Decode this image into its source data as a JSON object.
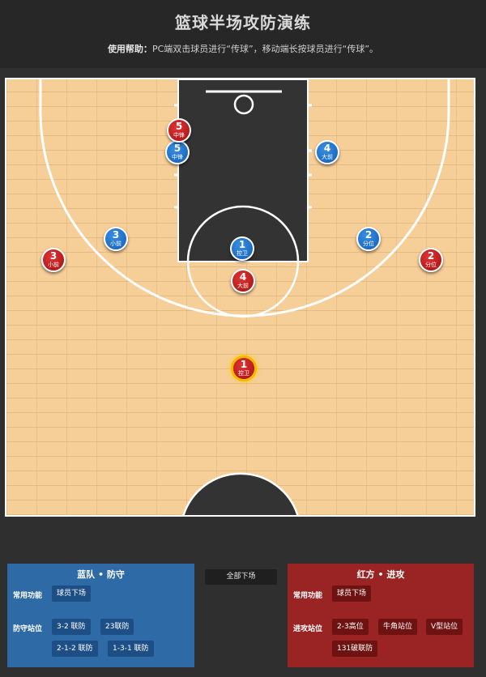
{
  "header": {
    "title": "篮球半场攻防演练",
    "help_label": "使用帮助：",
    "help_text": "PC端双击球员进行“传球”，移动端长按球员进行“传球”。"
  },
  "players": {
    "blue": [
      {
        "num": "5",
        "pos": "中锋"
      },
      {
        "num": "4",
        "pos": "大前"
      },
      {
        "num": "3",
        "pos": "小前"
      },
      {
        "num": "2",
        "pos": "分位"
      },
      {
        "num": "1",
        "pos": "控卫"
      }
    ],
    "red": [
      {
        "num": "5",
        "pos": "中锋"
      },
      {
        "num": "3",
        "pos": "小前"
      },
      {
        "num": "2",
        "pos": "分位"
      },
      {
        "num": "4",
        "pos": "大前"
      },
      {
        "num": "1",
        "pos": "控卫"
      }
    ]
  },
  "blue_panel": {
    "title": "蓝队 • 防守",
    "common_label": "常用功能",
    "btn_bench": "球员下场",
    "station_label": "防守站位",
    "btn_32": "3-2 联防",
    "btn_23": "23联防",
    "btn_212": "2-1-2 联防",
    "btn_131": "1-3-1 联防"
  },
  "all_bench": "全部下场",
  "red_panel": {
    "title": "红方 • 进攻",
    "common_label": "常用功能",
    "btn_bench": "球员下场",
    "station_label": "进攻站位",
    "btn_high": "2-3高位",
    "btn_horn": "牛角站位",
    "btn_v": "V型站位",
    "btn_131": "131破联防"
  },
  "colors": {
    "court": "#f5ce98",
    "paint": "#333333",
    "blue_team": "#1565c0",
    "red_team": "#c0141c",
    "ball_holder_ring": "#f5b800"
  }
}
